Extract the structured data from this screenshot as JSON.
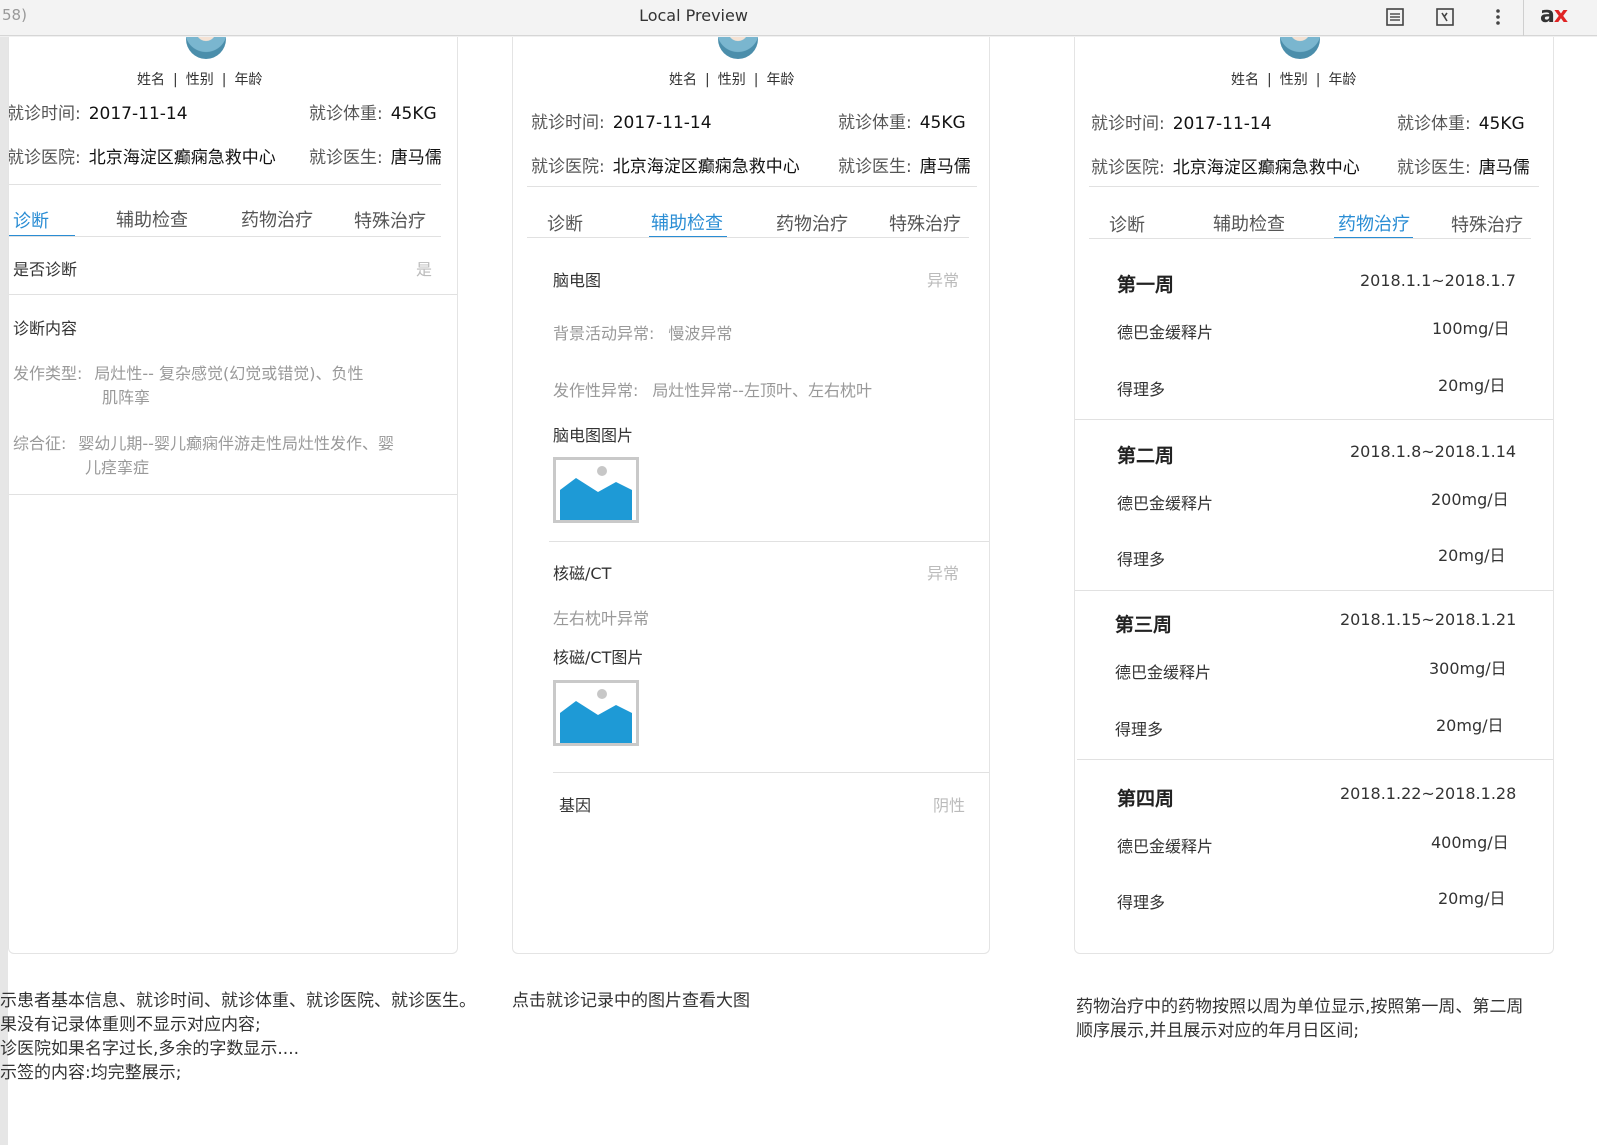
{
  "window": {
    "left_fragment": "58)",
    "title": "Local Preview",
    "brand_prefix": "a",
    "brand_suffix": "x"
  },
  "patient": {
    "name": "姓名",
    "gender": "性别",
    "age": "年龄",
    "visit_time_label": "就诊时间:",
    "visit_time": "2017-11-14",
    "visit_weight_label": "就诊体重:",
    "visit_weight": "45KG",
    "hospital_label": "就诊医院:",
    "hospital": "北京海淀区癫痫急救中心",
    "doctor_label": "就诊医生:",
    "doctor": "唐马儒"
  },
  "tabs": [
    "诊断",
    "辅助检查",
    "药物治疗",
    "特殊治疗"
  ],
  "diagnosis": {
    "is_diagnosed_label": "是否诊断",
    "is_diagnosed_value": "是",
    "content_label": "诊断内容",
    "seizure_type_label": "发作类型:",
    "seizure_type_line1": "局灶性-- 复杂感觉(幻觉或错觉)、负性",
    "seizure_type_line2": "肌阵挛",
    "syndrome_label": "综合征:",
    "syndrome_line1": "婴幼儿期--婴儿癫痫伴游走性局灶性发作、婴",
    "syndrome_line2": "儿痉挛症"
  },
  "auxiliary": {
    "eeg_label": "脑电图",
    "eeg_status": "异常",
    "background_label": "背景活动异常:",
    "background_value": "慢波异常",
    "paroxysmal_label": "发作性异常:",
    "paroxysmal_value": "局灶性异常--左顶叶、左右枕叶",
    "eeg_image_label": "脑电图图片",
    "mri_label": "核磁/CT",
    "mri_status": "异常",
    "mri_finding": "左右枕叶异常",
    "mri_image_label": "核磁/CT图片",
    "gene_label": "基因",
    "gene_status": "阴性"
  },
  "medication": {
    "weeks": [
      {
        "title": "第一周",
        "range": "2018.1.1~2018.1.7",
        "drugs": [
          {
            "name": "德巴金缓释片",
            "dose": "100mg/日"
          },
          {
            "name": "得理多",
            "dose": "20mg/日"
          }
        ]
      },
      {
        "title": "第二周",
        "range": "2018.1.8~2018.1.14",
        "drugs": [
          {
            "name": "德巴金缓释片",
            "dose": "200mg/日"
          },
          {
            "name": "得理多",
            "dose": "20mg/日"
          }
        ]
      },
      {
        "title": "第三周",
        "range": "2018.1.15~2018.1.21",
        "drugs": [
          {
            "name": "德巴金缓释片",
            "dose": "300mg/日"
          },
          {
            "name": "得理多",
            "dose": "20mg/日"
          }
        ]
      },
      {
        "title": "第四周",
        "range": "2018.1.22~2018.1.28",
        "drugs": [
          {
            "name": "德巴金缓释片",
            "dose": "400mg/日"
          },
          {
            "name": "得理多",
            "dose": "20mg/日"
          }
        ]
      }
    ]
  },
  "notes": {
    "left": [
      "示患者基本信息、就诊时间、就诊体重、就诊医院、就诊医生。",
      "果没有记录体重则不显示对应内容;",
      "诊医院如果名字过长,多余的字数显示....",
      "示签的内容:均完整展示;"
    ],
    "middle": "点击就诊记录中的图片查看大图",
    "right": [
      "药物治疗中的药物按照以周为单位显示,按照第一周、第二周",
      "顺序展示,并且展示对应的年月日区间;"
    ]
  },
  "icons": {
    "reader": "reader-view-icon",
    "devtools": "devtools-icon",
    "more": "more-vertical-icon",
    "image_placeholder": "image-placeholder-icon"
  },
  "colors": {
    "accent": "#2a8dd4",
    "image_blue": "#1e9ad6"
  }
}
